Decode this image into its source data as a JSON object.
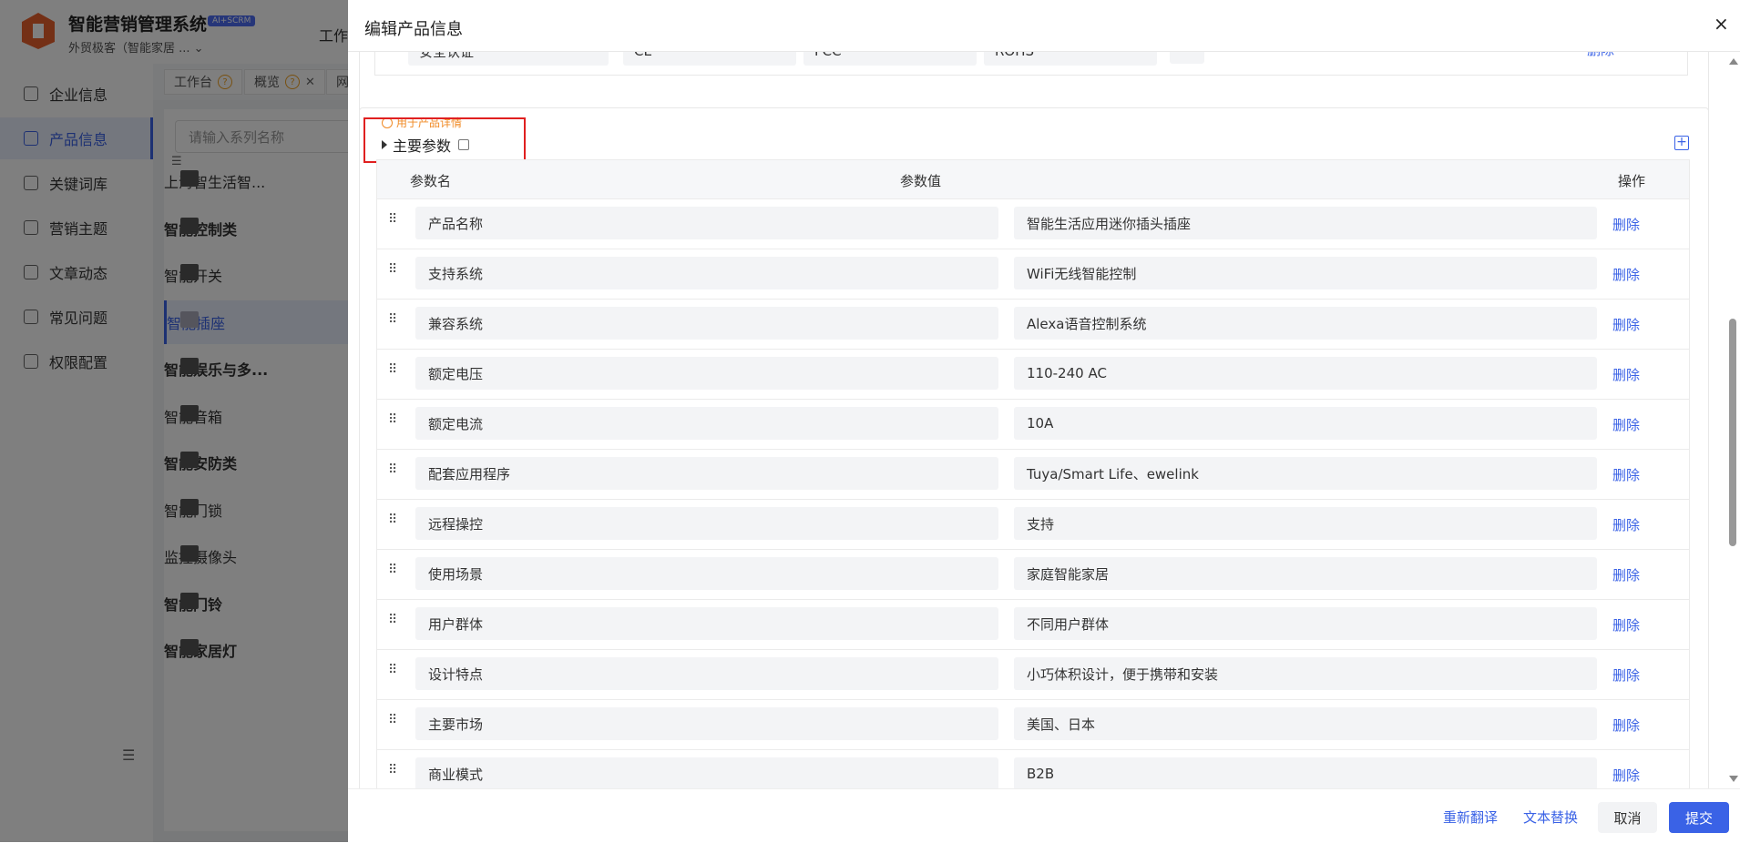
{
  "app": {
    "title": "智能营销管理系统",
    "badge": "AI+SCRM",
    "subtitle": "外贸极客（智能家居 ... ⌄",
    "top_tab": "工作"
  },
  "sidebar": {
    "items": [
      {
        "label": "企业信息",
        "icon": "building-icon"
      },
      {
        "label": "产品信息",
        "icon": "grid-icon"
      },
      {
        "label": "关键词库",
        "icon": "doc-icon"
      },
      {
        "label": "营销主题",
        "icon": "megaphone-icon"
      },
      {
        "label": "文章动态",
        "icon": "article-icon"
      },
      {
        "label": "常见问题",
        "icon": "question-icon"
      },
      {
        "label": "权限配置",
        "icon": "shield-icon"
      }
    ],
    "active_index": 1
  },
  "page_tabs": [
    {
      "label": "工作台"
    },
    {
      "label": "概览"
    },
    {
      "label": "网"
    }
  ],
  "series": {
    "search_placeholder": "请输入系列名称",
    "items": [
      {
        "label": "上海智生活智...",
        "bold": false
      },
      {
        "label": "智能控制类",
        "bold": true
      },
      {
        "label": "智能开关",
        "bold": false
      },
      {
        "label": "智能插座",
        "bold": false,
        "active": true
      },
      {
        "label": "智能娱乐与多...",
        "bold": true
      },
      {
        "label": "智能音箱",
        "bold": false
      },
      {
        "label": "智能安防类",
        "bold": true
      },
      {
        "label": "智能门锁",
        "bold": false
      },
      {
        "label": "监控摄像头",
        "bold": false
      },
      {
        "label": "智能门铃",
        "bold": true
      },
      {
        "label": "智能家居灯",
        "bold": true
      }
    ]
  },
  "drawer": {
    "title": "编辑产品信息",
    "close_label": "×",
    "top_section": {
      "cert_values": [
        "安全认证",
        "CE",
        "FCC",
        "ROHS"
      ],
      "delete_label": "删除"
    },
    "params_section": {
      "hint": "用于产品详情",
      "title": "主要参数",
      "add_label": "+",
      "columns": {
        "name": "参数名",
        "value": "参数值",
        "action": "操作"
      },
      "delete_label": "删除",
      "rows": [
        {
          "name": "产品名称",
          "value": "智能生活应用迷你插头插座"
        },
        {
          "name": "支持系统",
          "value": "WiFi无线智能控制"
        },
        {
          "name": "兼容系统",
          "value": "Alexa语音控制系统"
        },
        {
          "name": "额定电压",
          "value": "110-240 AC"
        },
        {
          "name": "额定电流",
          "value": "10A"
        },
        {
          "name": "配套应用程序",
          "value": "Tuya/Smart Life、ewelink"
        },
        {
          "name": "远程操控",
          "value": "支持"
        },
        {
          "name": "使用场景",
          "value": "家庭智能家居"
        },
        {
          "name": "用户群体",
          "value": "不同用户群体"
        },
        {
          "name": "设计特点",
          "value": "小巧体积设计，便于携带和安装"
        },
        {
          "name": "主要市场",
          "value": "美国、日本"
        },
        {
          "name": "商业模式",
          "value": "B2B"
        }
      ]
    },
    "footer": {
      "retranslate": "重新翻译",
      "replace_text": "文本替换",
      "cancel": "取消",
      "submit": "提交"
    }
  },
  "colors": {
    "accent": "#3a62e6",
    "warning": "#f08a24",
    "highlight_box": "#e02020"
  }
}
